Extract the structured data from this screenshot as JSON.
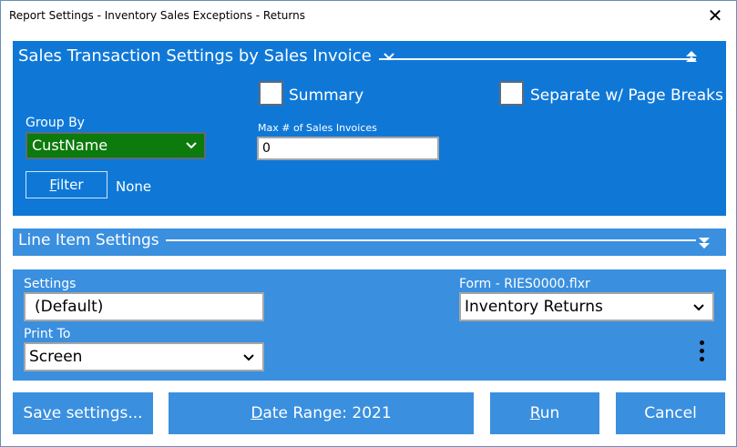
{
  "window": {
    "title": "Report Settings - Inventory Sales Exceptions - Returns",
    "close_glyph": "✕"
  },
  "sales_section": {
    "title": "Sales Transaction Settings by Sales Invoice",
    "summary_label": "Summary",
    "summary_checked": false,
    "page_breaks_label": "Separate w/ Page Breaks",
    "page_breaks_checked": false,
    "group_by_label": "Group By",
    "group_by_value": "CustName",
    "max_label": "Max # of Sales Invoices",
    "max_value": "0",
    "filter_pre": "",
    "filter_accel": "F",
    "filter_post": "ilter",
    "filter_value": "None"
  },
  "line_item_section": {
    "title": "Line Item Settings"
  },
  "output_section": {
    "settings_label": "Settings",
    "settings_value": "(Default)",
    "form_label": "Form - RIES0000.flxr",
    "form_value": "Inventory Returns",
    "print_to_label": "Print To",
    "print_to_value": "Screen"
  },
  "buttons": {
    "save_pre": "Sa",
    "save_accel": "v",
    "save_post": "e settings...",
    "date_pre": "",
    "date_accel": "D",
    "date_post": "ate Range: 2021",
    "run_pre": "",
    "run_accel": "R",
    "run_post": "un",
    "cancel": "Cancel"
  },
  "icons": {
    "chevron": "chevron-down-icon",
    "collapse_up": "double-chevron-up-icon",
    "expand_down": "double-chevron-down-icon",
    "more": "kebab-menu-icon"
  },
  "colors": {
    "primary_blue": "#0f78d7",
    "light_blue": "#3a8fdf",
    "group_green": "#0c7a0c"
  }
}
